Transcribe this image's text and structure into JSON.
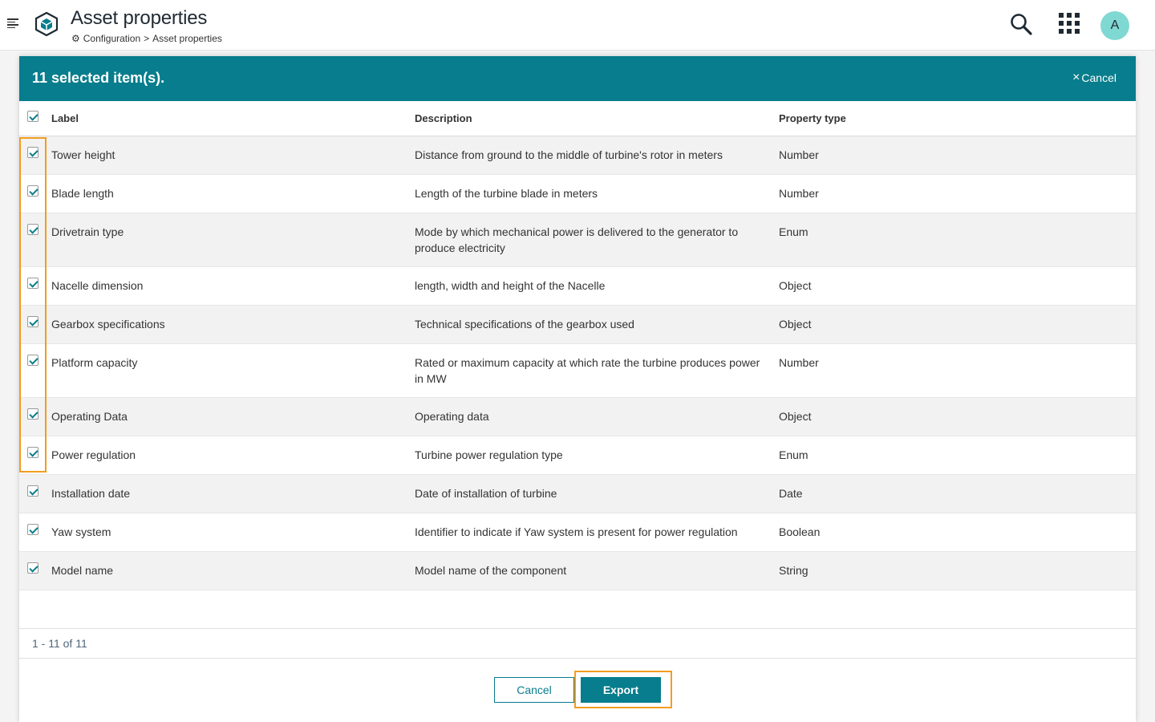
{
  "header": {
    "title": "Asset properties",
    "breadcrumb": {
      "root": "Configuration",
      "separator": ">",
      "current": "Asset properties"
    },
    "avatar_initial": "A"
  },
  "selection": {
    "count_text": "11 selected item(s).",
    "cancel_label": "Cancel"
  },
  "table": {
    "columns": {
      "label": "Label",
      "description": "Description",
      "type": "Property type"
    },
    "rows": [
      {
        "label": "Tower height",
        "description": "Distance from ground to the middle of turbine's rotor in meters",
        "type": "Number"
      },
      {
        "label": "Blade length",
        "description": "Length of the turbine blade in meters",
        "type": "Number"
      },
      {
        "label": "Drivetrain type",
        "description": "Mode by which mechanical power is delivered to the generator to produce electricity",
        "type": "Enum"
      },
      {
        "label": "Nacelle dimension",
        "description": "length, width and height of the Nacelle",
        "type": "Object"
      },
      {
        "label": "Gearbox specifications",
        "description": "Technical specifications of the gearbox used",
        "type": "Object"
      },
      {
        "label": "Platform capacity",
        "description": "Rated or maximum capacity at which rate the turbine produces power in MW",
        "type": "Number"
      },
      {
        "label": "Operating Data",
        "description": "Operating data",
        "type": "Object"
      },
      {
        "label": "Power regulation",
        "description": "Turbine power regulation type",
        "type": "Enum"
      },
      {
        "label": "Installation date",
        "description": "Date of installation of turbine",
        "type": "Date"
      },
      {
        "label": "Yaw system",
        "description": "Identifier to indicate if Yaw system is present for power regulation",
        "type": "Boolean"
      },
      {
        "label": "Model name",
        "description": "Model name of the component",
        "type": "String"
      }
    ]
  },
  "pagination": {
    "text": "1 - 11 of 11"
  },
  "actions": {
    "cancel_label": "Cancel",
    "export_label": "Export"
  },
  "colors": {
    "accent": "#077d8d",
    "highlight": "#f39c1f",
    "avatar_bg": "#80d8d2"
  }
}
